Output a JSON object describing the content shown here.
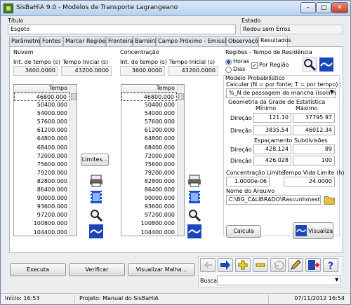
{
  "window": {
    "title": "SisBaHiA 9.0 - Modelos de Transporte Lagrangeano"
  },
  "header": {
    "title_label": "Título",
    "title_value": "Esgoto",
    "state_label": "Estado",
    "state_value": "Rodou sem Erros"
  },
  "tabs": [
    "Parâmetros",
    "Fontes",
    "Marcar Regiões",
    "Fronteira",
    "Barreira",
    "Campo Próximo - Emissários",
    "Observações",
    "Resultados"
  ],
  "active_tab": "Resultados",
  "nuvem": {
    "title": "Nuvem",
    "int_label": "Int. de tempo (s)",
    "int_value": "3600.0000",
    "tini_label": "Tempo Inicial (s)",
    "tini_value": "43200.0000",
    "list_header": "Tempo",
    "times": [
      "46800.000",
      "50400.000",
      "54000.000",
      "57600.000",
      "61200.000",
      "64800.000",
      "68400.000",
      "72000.000",
      "75600.000",
      "79200.000",
      "82800.000",
      "86400.000",
      "90000.000",
      "93600.000",
      "97200.000",
      "100800.000",
      "104400.000"
    ]
  },
  "concentracao": {
    "title": "Concentração",
    "int_label": "Int. de tempo (s)",
    "int_value": "3600.0000",
    "tini_label": "Tempo Inicial (s)",
    "tini_value": "43200.0000",
    "list_header": "Tempo",
    "times": [
      "46800.000",
      "50400.000",
      "54000.000",
      "57600.000",
      "61200.000",
      "64800.000",
      "68400.000",
      "72000.000",
      "75600.000",
      "79200.000",
      "82800.000",
      "86400.000",
      "90000.000",
      "93600.000",
      "97200.000",
      "100800.000",
      "104400.000"
    ]
  },
  "limites_button": "Limites...",
  "regioes": {
    "title": "Regiões - Tempo de Residência",
    "radio_horas": "Horas",
    "radio_dias": "Dias",
    "selected_unit": "Horas",
    "checkbox_label": "Por Região",
    "checkbox_checked": true
  },
  "modelo": {
    "title": "Modelo Probabilístico",
    "calc_label": "Calcular (N = por fonte; T = por tempo) :",
    "calc_value": "%_N de passagem da mancha (isolinhas)"
  },
  "grade": {
    "title": "Geometria da Grade de Estatística",
    "min_label": "Mínimo",
    "max_label": "Máximo",
    "dirx_label": "Direção X",
    "diry_label": "Direção Y",
    "min_x": "121.10",
    "max_x": "37795.97",
    "min_y": "3835.54",
    "max_y": "46012.34",
    "esp_label": "Espaçamento",
    "sub_label": "Subdivisões",
    "esp_x": "428.124",
    "sub_x": "89",
    "esp_y": "426.028",
    "sub_y": "100"
  },
  "conc_limite": {
    "label": "Concentração Limite",
    "value": "1.0000e-06"
  },
  "tempo_vida": {
    "label": "Tempo Vida Limite (h)",
    "value": "24.0000"
  },
  "arquivo": {
    "label": "Nome do Arquivo",
    "value": "C:\\BG_CALIBRADO\\Rascunho\\estatistica"
  },
  "calcula_button": "Calcula",
  "visualiza_button": "Visualiza",
  "bottom_buttons": {
    "executa": "Executa",
    "verificar": "Verificar",
    "malha": "Visualizar Malha..."
  },
  "busca": {
    "label": "Busca:",
    "value": ""
  },
  "status": {
    "inicio": "Início: 16:53",
    "projeto": "Projeto: Manual do SisBaHiA",
    "datetime": "07/11/2012 16:54"
  },
  "colors": {
    "accent": "#1a47b8",
    "selected_bg": "#ffffff"
  }
}
